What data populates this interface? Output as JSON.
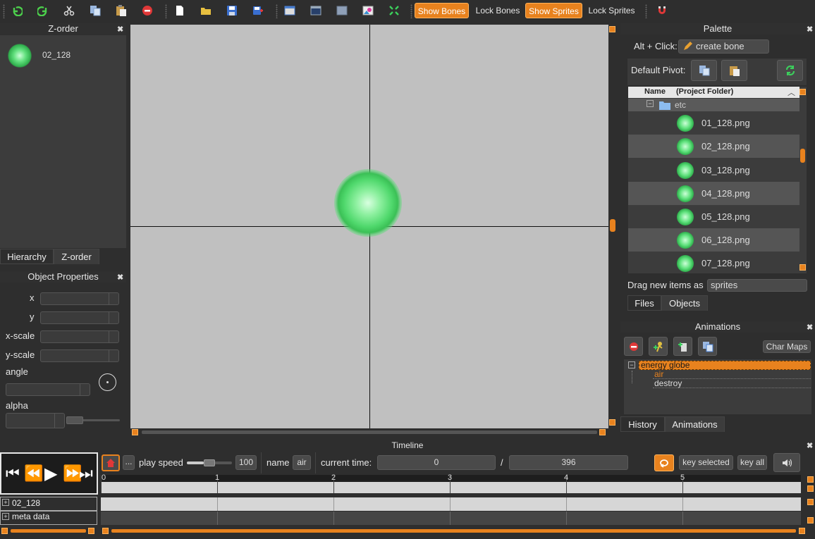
{
  "toolbar": {
    "show_bones": "Show Bones",
    "lock_bones": "Lock Bones",
    "show_sprites": "Show Sprites",
    "lock_sprites": "Lock Sprites"
  },
  "zorder": {
    "title": "Z-order",
    "items": [
      {
        "label": "02_128"
      }
    ],
    "tabs": [
      "Hierarchy",
      "Z-order"
    ]
  },
  "props": {
    "title": "Object Properties",
    "labels": {
      "x": "x",
      "y": "y",
      "xscale": "x-scale",
      "yscale": "y-scale",
      "angle": "angle",
      "alpha": "alpha"
    }
  },
  "palette": {
    "title": "Palette",
    "alt_click": "Alt + Click:",
    "create_bone": "create bone",
    "default_pivot": "Default Pivot:",
    "col_name": "Name",
    "col_folder": "(Project Folder)",
    "folder": "etc",
    "files": [
      "01_128.png",
      "02_128.png",
      "03_128.png",
      "04_128.png",
      "05_128.png",
      "06_128.png",
      "07_128.png"
    ],
    "drag_label": "Drag new items as",
    "drag_value": "sprites",
    "tabs": [
      "Files",
      "Objects"
    ]
  },
  "animations": {
    "title": "Animations",
    "char_maps": "Char Maps",
    "entity": "energy globe",
    "anims": [
      "air",
      "destroy"
    ],
    "tabs": [
      "History",
      "Animations"
    ]
  },
  "timeline": {
    "title": "Timeline",
    "play_speed_label": "play speed",
    "play_speed": "100",
    "name_label": "name",
    "name_value": "air",
    "current_time_label": "current time:",
    "current_time": "0",
    "slash": "/",
    "total_time": "396",
    "key_selected": "key selected",
    "key_all": "key all",
    "dots": "...",
    "ruler": [
      "0",
      "1",
      "2",
      "3",
      "4",
      "5"
    ],
    "tracks": [
      "02_128",
      "meta data"
    ]
  },
  "colors": {
    "accent": "#e8821e",
    "canvas": "#c0c0c0",
    "panel": "#2e2e2e",
    "sprite": "#5ce07a"
  }
}
